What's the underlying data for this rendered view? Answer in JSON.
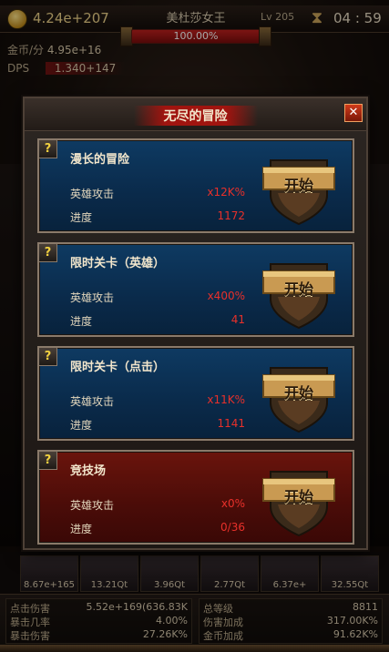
{
  "hud": {
    "gold": "4.24e+207",
    "boss_name": "美杜莎女王",
    "boss_hp": "100.00%",
    "boss_level": "Lv 205",
    "timer": "04 : 59",
    "gold_per_sec_label": "金币/分",
    "gold_per_sec_value": "4.95e+16",
    "dps_label": "DPS",
    "dps_value": "1.340+147"
  },
  "modal": {
    "title": "无尽的冒险",
    "close_label": "✕",
    "cards": [
      {
        "title": "漫长的冒险",
        "row1_label": "英雄攻击",
        "row1_value": "x12K%",
        "row2_label": "进度",
        "row2_value": "1172",
        "button": "开始",
        "help": "?",
        "theme": "blue"
      },
      {
        "title": "限时关卡（英雄）",
        "row1_label": "英雄攻击",
        "row1_value": "x400%",
        "row2_label": "进度",
        "row2_value": "41",
        "button": "开始",
        "help": "?",
        "theme": "blue"
      },
      {
        "title": "限时关卡（点击）",
        "row1_label": "英雄攻击",
        "row1_value": "x11K%",
        "row2_label": "进度",
        "row2_value": "1141",
        "button": "开始",
        "help": "?",
        "theme": "blue"
      },
      {
        "title": "竞技场",
        "row1_label": "英雄攻击",
        "row1_value": "x0%",
        "row2_label": "进度",
        "row2_value": "0/36",
        "button": "开始",
        "help": "?",
        "theme": "red"
      }
    ]
  },
  "heroes": [
    "8.67e+165",
    "13.21Qt",
    "3.96Qt",
    "2.77Qt",
    "6.37e+",
    "32.55Qt"
  ],
  "stats": {
    "left": [
      {
        "label": "点击伤害",
        "value": "5.52e+169(636.83K"
      },
      {
        "label": "暴击几率",
        "value": "4.00%"
      },
      {
        "label": "暴击伤害",
        "value": "27.26K%"
      }
    ],
    "right": [
      {
        "label": "总等级",
        "value": "8811"
      },
      {
        "label": "伤害加成",
        "value": "317.00K%"
      },
      {
        "label": "金币加成",
        "value": "91.62K%"
      }
    ]
  },
  "colors": {
    "card_blue": "#0a2a4a",
    "card_red": "#4a0c08",
    "value_red": "#e8302a",
    "gold": "#f0d58a"
  }
}
